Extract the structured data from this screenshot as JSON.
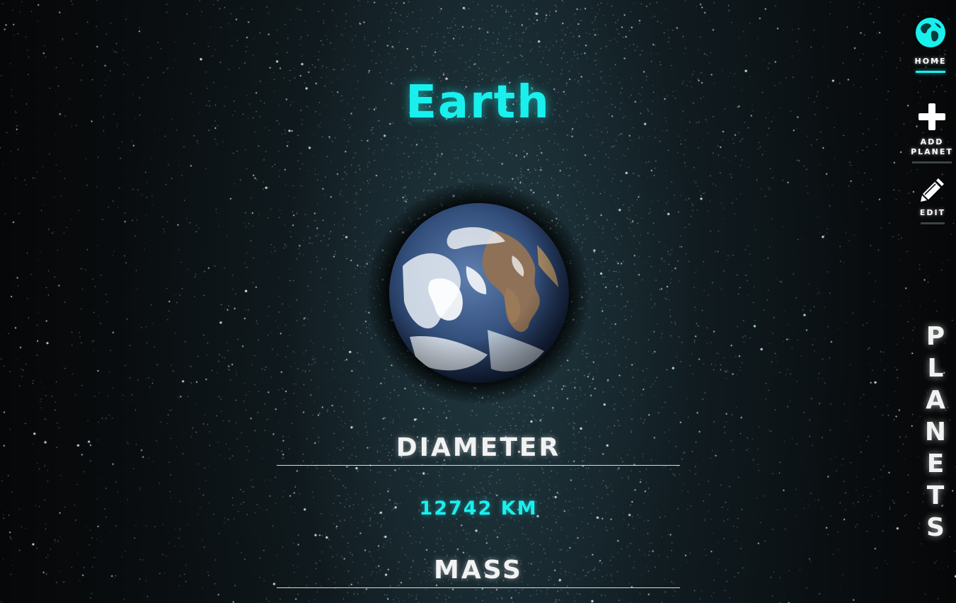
{
  "planet": {
    "name": "Earth"
  },
  "stats": {
    "diameter_label": "DIAMETER",
    "diameter_value": "12742 KM",
    "mass_label": "MASS"
  },
  "nav": {
    "home_label": "HOME",
    "add_label_line1": "ADD",
    "add_label_line2": "PLANET",
    "edit_label": "EDIT",
    "active": "home"
  },
  "sidebar_title": [
    "P",
    "L",
    "A",
    "N",
    "E",
    "T",
    "S"
  ],
  "icons": {
    "home": "globe-icon",
    "add": "plus-icon",
    "edit": "pencil-icon"
  },
  "colors": {
    "accent": "#19f0ee",
    "text": "#f2f2f2",
    "background": "#050607"
  }
}
